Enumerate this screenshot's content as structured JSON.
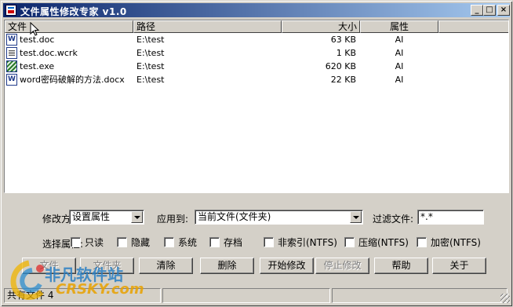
{
  "window": {
    "title": "文件属性修改专家 v1.0"
  },
  "columns": [
    "文件",
    "路径",
    "大小",
    "属性"
  ],
  "files": [
    {
      "name": "test.doc",
      "path": "E:\\test",
      "size": "63 KB",
      "attr": "AI",
      "icon": "word-doc-icon"
    },
    {
      "name": "test.doc.wcrk",
      "path": "E:\\test",
      "size": "1 KB",
      "attr": "AI",
      "icon": "generic-file-icon"
    },
    {
      "name": "test.exe",
      "path": "E:\\test",
      "size": "620 KB",
      "attr": "AI",
      "icon": "exe-file-icon"
    },
    {
      "name": "word密码破解的方法.docx",
      "path": "E:\\test",
      "size": "22 KB",
      "attr": "AI",
      "icon": "word-doc-icon"
    }
  ],
  "options": {
    "mode_label": "修改方式:",
    "mode_value": "设置属性",
    "apply_label": "应用到:",
    "apply_value": "当前文件(文件夹)",
    "filter_label": "过滤文件:",
    "filter_value": "*.*",
    "select_label": "选择属性:",
    "attributes": [
      "只读",
      "隐藏",
      "系统",
      "存档",
      "非索引(NTFS)",
      "压缩(NTFS)",
      "加密(NTFS)"
    ]
  },
  "buttons": {
    "file": "文件",
    "folder": "文件夹",
    "clear": "清除",
    "delete": "删除",
    "start": "开始修改",
    "stop": "停止修改",
    "help": "帮助",
    "about": "关于"
  },
  "status": {
    "text": "共有文件 4"
  },
  "watermark": {
    "brand": "非凡软件站",
    "site": "CRSKY.com"
  }
}
